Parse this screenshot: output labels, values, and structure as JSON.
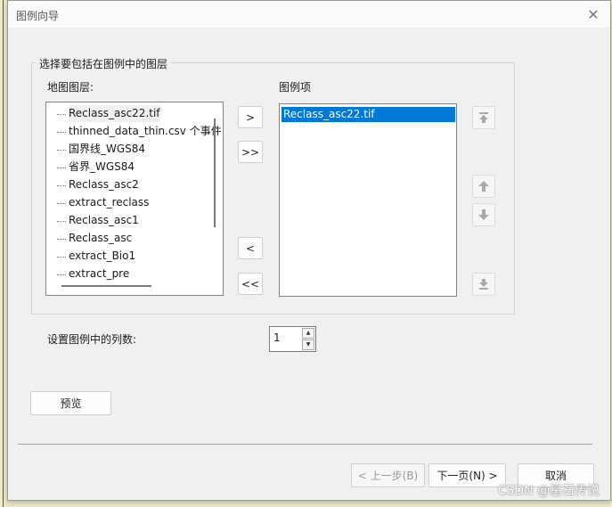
{
  "dialog": {
    "title": "图例向导",
    "close_glyph": "✕"
  },
  "group": {
    "title": "选择要包括在图例中的图层",
    "map_layers_label": "地图图层:",
    "legend_items_label": "图例项"
  },
  "map_layers": [
    "Reclass_asc22.tif",
    "thinned_data_thin.csv 个事件",
    "国界线_WGS84",
    "省界_WGS84",
    "Reclass_asc2",
    "extract_reclass",
    "Reclass_asc1",
    "Reclass_asc",
    "extract_Bio1",
    "extract_pre"
  ],
  "legend_items": [
    "Reclass_asc22.tif"
  ],
  "transfer_buttons": {
    "add": ">",
    "add_all": ">>",
    "remove": "<",
    "remove_all": "<<"
  },
  "columns": {
    "label": "设置图例中的列数:",
    "value": "1"
  },
  "preview_label": "预览",
  "footer": {
    "back_label": "< 上一步(B)",
    "next_label": "下一页(N) >",
    "cancel_label": "取消"
  },
  "watermark": "CSDN @星石传说"
}
